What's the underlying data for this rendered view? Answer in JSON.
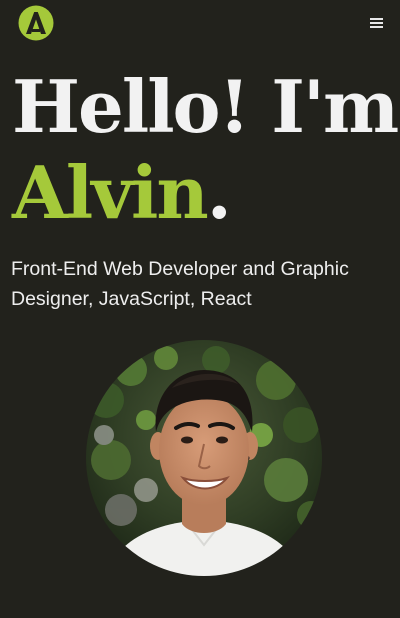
{
  "header": {
    "logo_icon": "logo-a-icon",
    "menu_icon": "hamburger-menu-icon"
  },
  "hero": {
    "greeting": "Hello! I'm",
    "name": "Alvin",
    "name_punct": ".",
    "subtitle": "Front-End Web Developer and Graphic Designer, JavaScript, React",
    "photo_icon": "profile-photo-avatar"
  },
  "colors": {
    "background": "#22221c",
    "accent": "#a5c93a",
    "text": "#f2f2f2"
  }
}
